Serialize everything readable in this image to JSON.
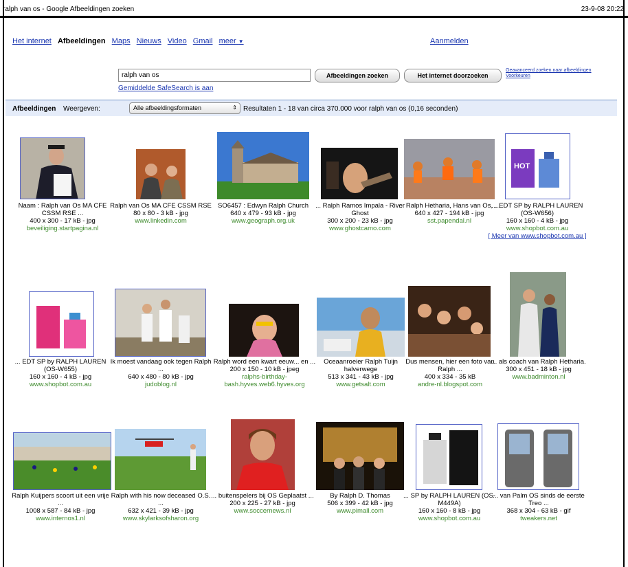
{
  "window": {
    "title": "ralph van os - Google Afbeeldingen zoeken",
    "date": "23-9-08 20:22"
  },
  "nav": {
    "items": [
      "Het internet",
      "Afbeeldingen",
      "Maps",
      "Nieuws",
      "Video",
      "Gmail",
      "meer"
    ],
    "more_arrow": "▼",
    "signin": "Aanmelden"
  },
  "search": {
    "value": "ralph van os",
    "button_images": "Afbeeldingen zoeken",
    "button_web": "Het internet doorzoeken",
    "advanced": [
      "Geavanceerd zoeken naar afbeeldingen",
      "Voorkeuren"
    ],
    "safesearch": "Gemiddelde SafeSearch is aan"
  },
  "results_bar": {
    "label": "Afbeeldingen",
    "show_label": "Weergeven:",
    "format_select": "Alle afbeeldingsformaten",
    "summary": "Resultaten 1 - 18 van circa 370.000 voor ralph van os (0,16 seconden)"
  },
  "results": [
    {
      "title": "Naam : Ralph van Os MA CFE CSSM RSE ...",
      "meta": "400 x 300 - 17 kB - jpg",
      "url": "beveiliging.startpagina.nl"
    },
    {
      "title": "Ralph van Os MA CFE CSSM RSE",
      "meta": "80 x 80 - 3 kB - jpg",
      "url": "www.linkedin.com"
    },
    {
      "title": "SO6457 : Edwyn Ralph Church",
      "meta": "640 x 479 - 93 kB - jpg",
      "url": "www.geograph.org.uk"
    },
    {
      "title": "... Ralph Ramos Impala - River Ghost",
      "meta": "300 x 200 - 23 kB - jpg",
      "url": "www.ghostcamo.com"
    },
    {
      "title": "... Ralph Hetharia, Hans van Os, ...",
      "meta": "640 x 427 - 194 kB - jpg",
      "url": "sst.papendal.nl"
    },
    {
      "title": "... EDT SP by RALPH LAUREN (OS-W656)",
      "meta": "160 x 160 - 4 kB - jpg",
      "url": "www.shopbot.com.au",
      "more": "[ Meer van www.shopbot.com.au ]"
    },
    {
      "title": "... EDT SP by RALPH LAUREN (OS-W655)",
      "meta": "160 x 160 - 4 kB - jpg",
      "url": "www.shopbot.com.au"
    },
    {
      "title": "Ik moest vandaag ook tegen Ralph ...",
      "meta": "640 x 480 - 80 kB - jpg",
      "url": "judoblog.nl"
    },
    {
      "title": "Ralph word een kwart eeuw... en ...",
      "meta": "200 x 150 - 10 kB - jpeg",
      "url": "ralphs-birthday-bash.hyves.web6.hyves.org"
    },
    {
      "title": "Oceaanroeier Ralph Tuijn halverwege",
      "meta": "513 x 341 - 43 kB - jpg",
      "url": "www.getsalt.com"
    },
    {
      "title": "Dus mensen, hier een foto van Ralph ...",
      "meta": "400 x 334 - 35 kB",
      "url": "andre-nl.blogspot.com"
    },
    {
      "title": "... als coach van Ralph Hetharia.",
      "meta": "300 x 451 - 18 kB - jpg",
      "url": "www.badminton.nl"
    },
    {
      "title": "Ralph Kuijpers scoort uit een vrije ...",
      "meta": "1008 x 587 - 84 kB - jpg",
      "url": "www.internos1.nl"
    },
    {
      "title": "Ralph with his now deceased O.S. ...",
      "meta": "632 x 421 - 39 kB - jpg",
      "url": "www.skylarksofsharon.org"
    },
    {
      "title": "... buitenspelers bij OS Geplaatst ...",
      "meta": "200 x 225 - 27 kB - jpg",
      "url": "www.soccernews.nl"
    },
    {
      "title": "By Ralph D. Thomas",
      "meta": "506 x 399 - 42 kB - jpg",
      "url": "www.pimall.com"
    },
    {
      "title": "... SP by RALPH LAUREN (OS-M449A)",
      "meta": "160 x 160 - 8 kB - jpg",
      "url": "www.shopbot.com.au"
    },
    {
      "title": "... van Palm OS sinds de eerste Treo ...",
      "meta": "368 x 304 - 63 kB - gif",
      "url": "tweakers.net"
    }
  ],
  "colors": {
    "link": "#1a36b0",
    "url_green": "#3d8a2c",
    "results_bar": "#e5ecf9",
    "thumb_border": "#5463c7"
  }
}
